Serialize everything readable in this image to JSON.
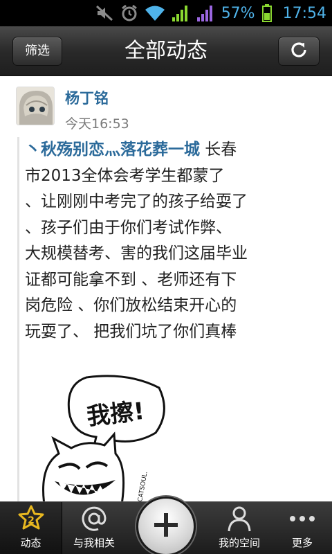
{
  "status_bar": {
    "battery_percent": "57%",
    "time": "17:54",
    "icons": [
      "mute-icon",
      "alarm-icon",
      "wifi-icon",
      "signal-green-icon",
      "signal-purple-icon",
      "battery-icon"
    ]
  },
  "header": {
    "title": "全部动态",
    "filter_label": "筛选",
    "refresh_icon": "refresh-icon"
  },
  "post": {
    "author": "杨丁铭",
    "time": "今天16:53",
    "mention": "丶秋殇别恋灬落花葬一城",
    "lines": [
      " 长春",
      "市2013全体会考学生都蒙了",
      "、让刚刚中考完了的孩子给耍了",
      "、孩子们由于你们考试作弊、",
      "大规模替考、害的我们这届毕业",
      "证都可能拿不到 、老师还有下",
      "岗危险 、你们放松结束开心的",
      "玩耍了、 把我们坑了你们真棒"
    ],
    "sticker_text": "我擦!",
    "sticker_signature": "CATSOUL."
  },
  "bottom_nav": {
    "tabs": [
      {
        "label": "动态",
        "icon": "activity-badge-icon",
        "badge": "2"
      },
      {
        "label": "与我相关",
        "icon": "at-icon"
      },
      {
        "label": "我的空间",
        "icon": "person-icon"
      },
      {
        "label": "更多",
        "icon": "more-icon"
      }
    ],
    "add_icon": "plus-icon"
  },
  "colors": {
    "accent_blue": "#4fb3ea",
    "link_blue": "#2b6a9a",
    "bar_dark": "#2a2a2a"
  }
}
